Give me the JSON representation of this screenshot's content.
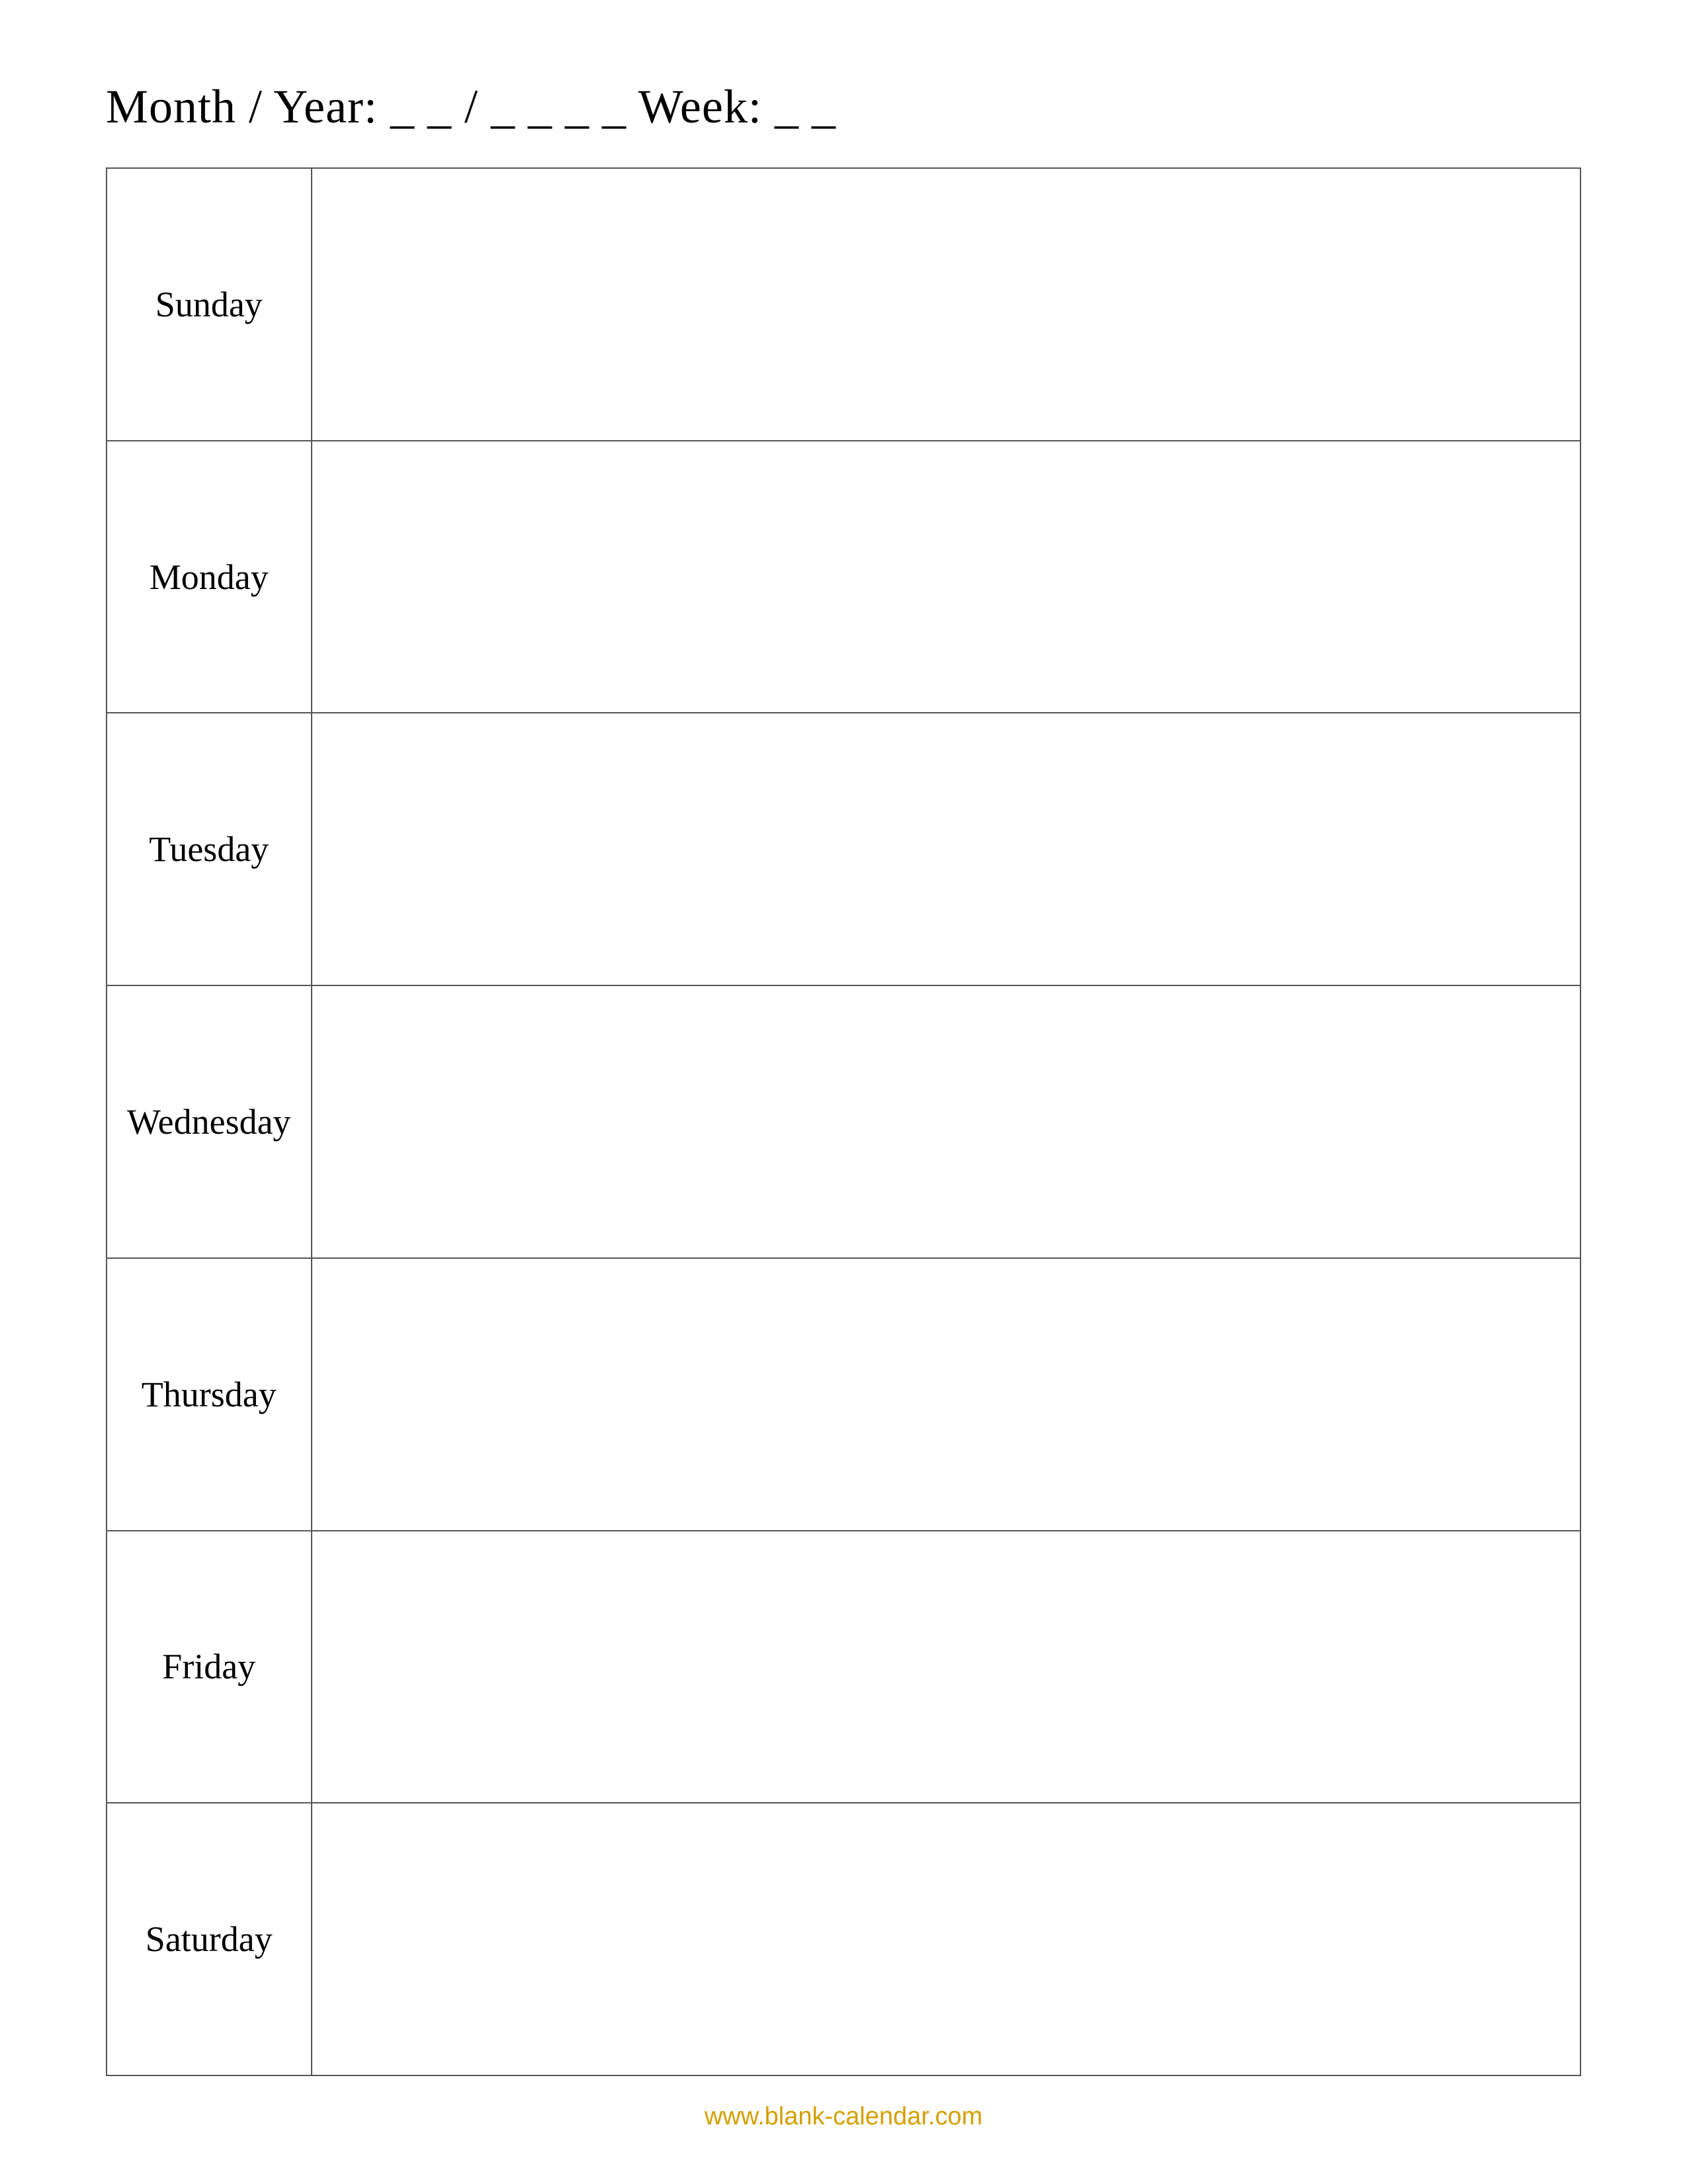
{
  "header": {
    "text": "Month / Year: _ _ / _ _ _ _   Week: _ _"
  },
  "days": [
    {
      "label": "Sunday"
    },
    {
      "label": "Monday"
    },
    {
      "label": "Tuesday"
    },
    {
      "label": "Wednesday"
    },
    {
      "label": "Thursday"
    },
    {
      "label": "Friday"
    },
    {
      "label": "Saturday"
    }
  ],
  "footer": {
    "url_text": "www.blank-calendar.com",
    "url": "http://www.blank-calendar.com"
  }
}
